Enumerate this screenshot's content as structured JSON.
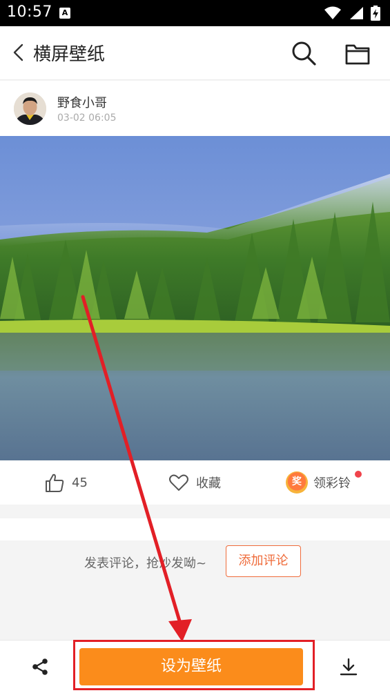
{
  "status_bar": {
    "time": "10:57",
    "notification_glyph": "A",
    "icons": [
      "wifi-icon",
      "signal-icon",
      "battery-charging-icon"
    ]
  },
  "app_bar": {
    "title": "横屏壁纸",
    "icons": [
      "back-arrow-icon",
      "search-icon",
      "folder-icon"
    ]
  },
  "author": {
    "name": "野食小哥",
    "timestamp": "03-02 06:05"
  },
  "actions": {
    "like_count": "45",
    "favorite_label": "收藏",
    "ringtone_label": "领彩铃",
    "prize_badge_text": "奖"
  },
  "comments": {
    "prompt": "发表评论，抢沙发呦~",
    "add_button": "添加评论"
  },
  "bottom_bar": {
    "set_wallpaper_label": "设为壁纸",
    "icons": [
      "share-icon",
      "download-icon"
    ]
  },
  "colors": {
    "accent_orange": "#fb8c1b",
    "comment_button_border": "#ef6b3a",
    "annotation_red": "#e21f26",
    "notification_dot": "#f0434b"
  }
}
